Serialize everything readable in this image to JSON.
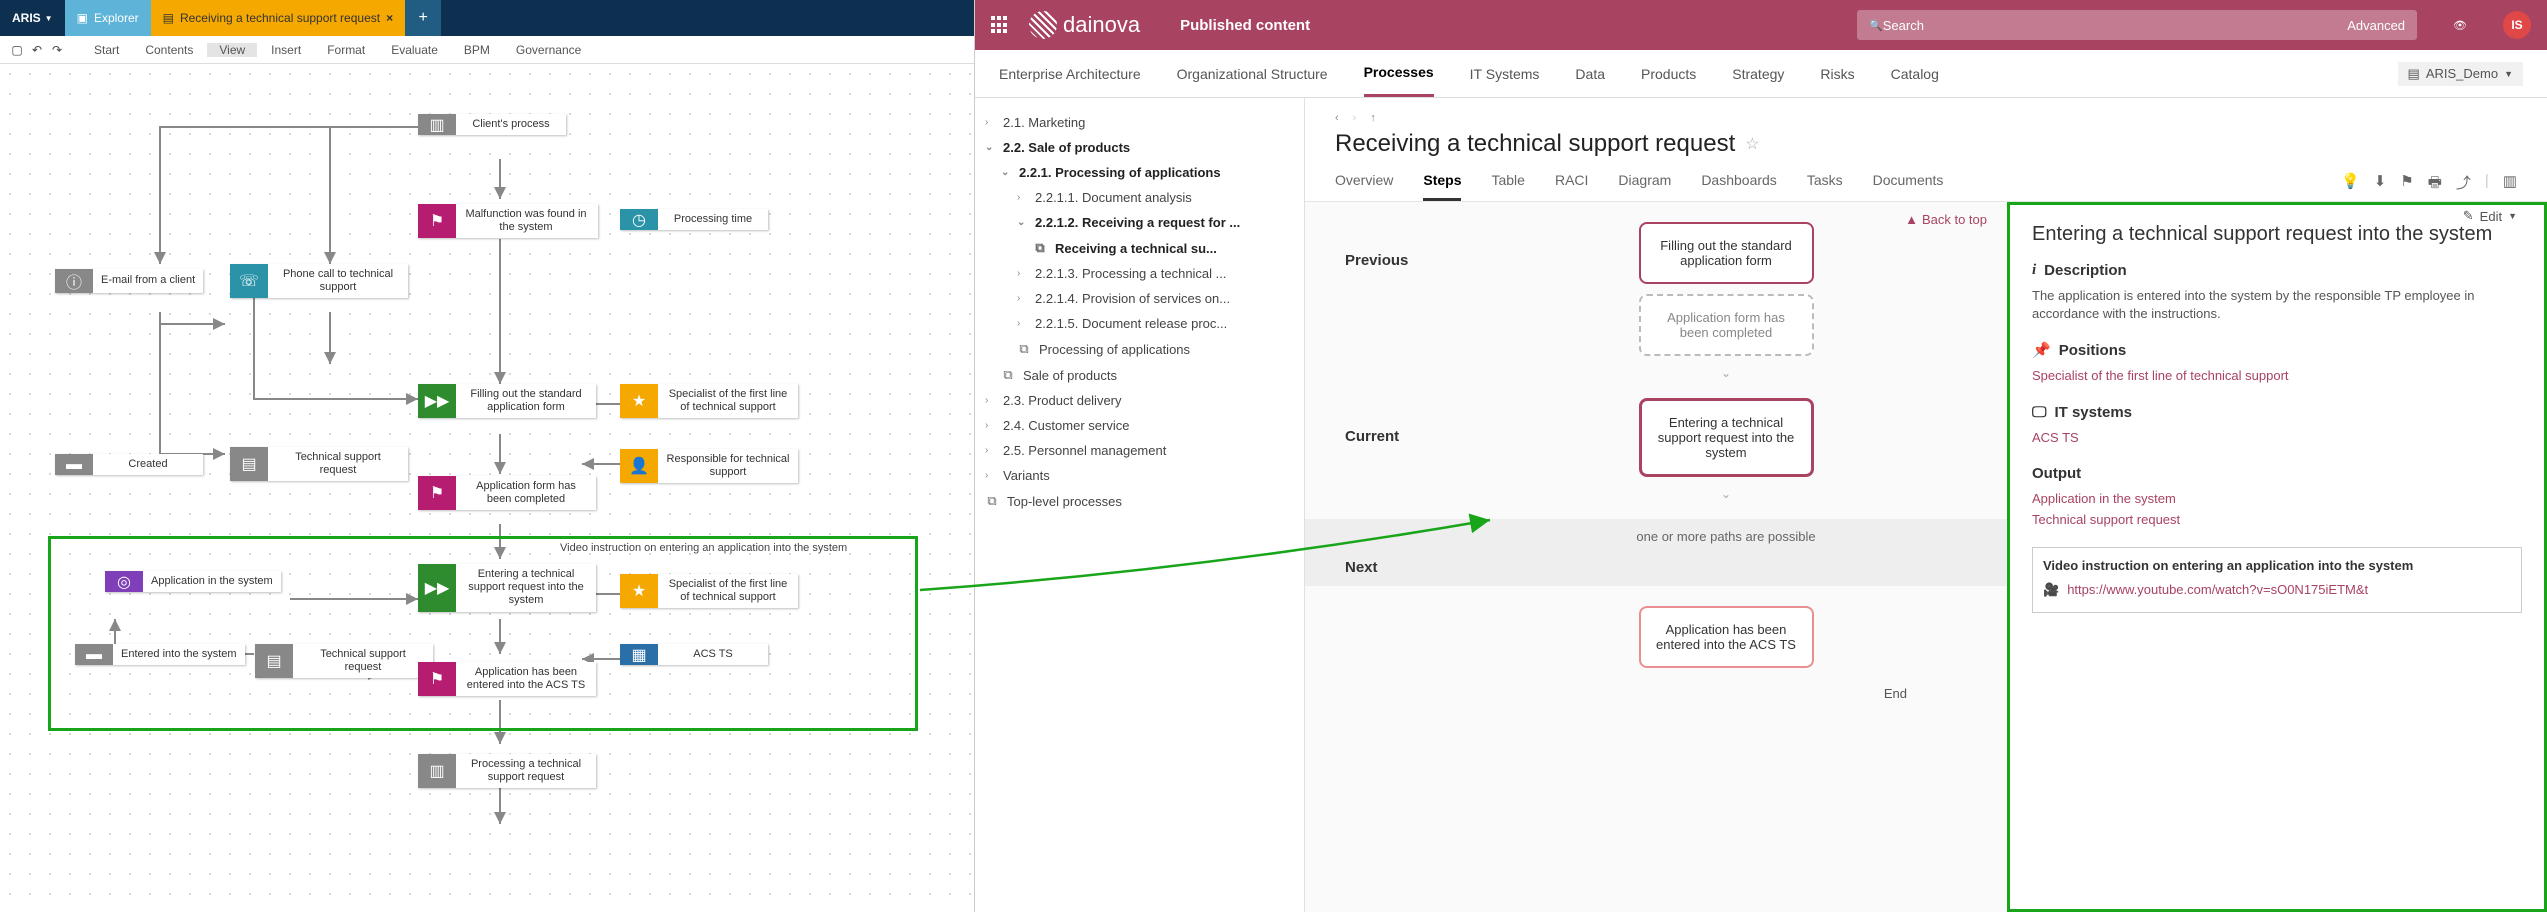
{
  "aris": {
    "home": "ARIS",
    "tabs": {
      "explorer": "Explorer",
      "doc": "Receiving a technical support request"
    },
    "menu": [
      "Start",
      "Contents",
      "View",
      "Insert",
      "Format",
      "Evaluate",
      "BPM",
      "Governance"
    ],
    "active_menu": "View"
  },
  "diagram": {
    "n_client_process": "Client's process",
    "n_email": "E-mail from a client",
    "n_phone": "Phone call to technical support",
    "n_malfunction": "Malfunction was found in the system",
    "n_proc_time": "Processing time",
    "n_fill_form": "Filling out the standard application form",
    "n_spec_first": "Specialist of the first line of technical support",
    "n_created": "Created",
    "n_tsr1": "Technical support request",
    "n_form_done": "Application form has been completed",
    "n_resp": "Responsible for technical support",
    "n_app_in_sys": "Application in the system",
    "n_enter_req": "Entering a technical support request into the system",
    "n_spec_first2": "Specialist of the first line of technical support",
    "n_entered": "Entered into the system",
    "n_tsr2": "Technical support request",
    "n_acsts": "ACS TS",
    "n_app_entered": "Application has been entered into the ACS TS",
    "n_processing": "Processing a technical support request",
    "annot": "Video instruction on entering an application into the system"
  },
  "portal": {
    "brand": "dainova",
    "published": "Published content",
    "search_ph": "Search",
    "adv": "Advanced",
    "avatar": "IS",
    "nav": [
      "Enterprise Architecture",
      "Organizational Structure",
      "Processes",
      "IT Systems",
      "Data",
      "Products",
      "Strategy",
      "Risks",
      "Catalog"
    ],
    "nav_active": "Processes",
    "demo": "ARIS_Demo"
  },
  "tree": {
    "i1": "2.1. Marketing",
    "i2": "2.2. Sale of products",
    "i3": "2.2.1. Processing of applications",
    "i4": "2.2.1.1. Document analysis",
    "i5": "2.2.1.2. Receiving a request for ...",
    "i5a": "Receiving a technical su...",
    "i6": "2.2.1.3. Processing a technical ...",
    "i7": "2.2.1.4. Provision of services on...",
    "i8": "2.2.1.5. Document release proc...",
    "i9": "Processing of applications",
    "i10": "Sale of products",
    "i11": "2.3. Product delivery",
    "i12": "2.4. Customer service",
    "i13": "2.5. Personnel management",
    "i14": "Variants",
    "i15": "Top-level processes"
  },
  "main": {
    "title": "Receiving a technical support request",
    "edit": "Edit",
    "tabs": [
      "Overview",
      "Steps",
      "Table",
      "RACI",
      "Diagram",
      "Dashboards",
      "Tasks",
      "Documents"
    ],
    "tab_active": "Steps",
    "backtop": "Back to top",
    "stages": {
      "prev": "Previous",
      "cur": "Current",
      "next": "Next"
    },
    "b1": "Filling out the standard application form",
    "b2": "Application form has been completed",
    "b3": "Entering a technical support request into the system",
    "b4txt": "one or more paths are possible",
    "b5": "Application has been entered into the ACS TS",
    "end": "End"
  },
  "side": {
    "title": "Entering a technical support request into the system",
    "desc_h": "Description",
    "desc": "The application is entered into the system by the responsible TP employee in accordance with the instructions.",
    "pos_h": "Positions",
    "pos1": "Specialist of the first line of technical support",
    "it_h": "IT systems",
    "it1": "ACS TS",
    "out_h": "Output",
    "out1": "Application in the system",
    "out2": "Technical support request",
    "vid_h": "Video instruction on entering an application into the system",
    "vid_url": "https://www.youtube.com/watch?v=sO0N175iETM&t"
  }
}
